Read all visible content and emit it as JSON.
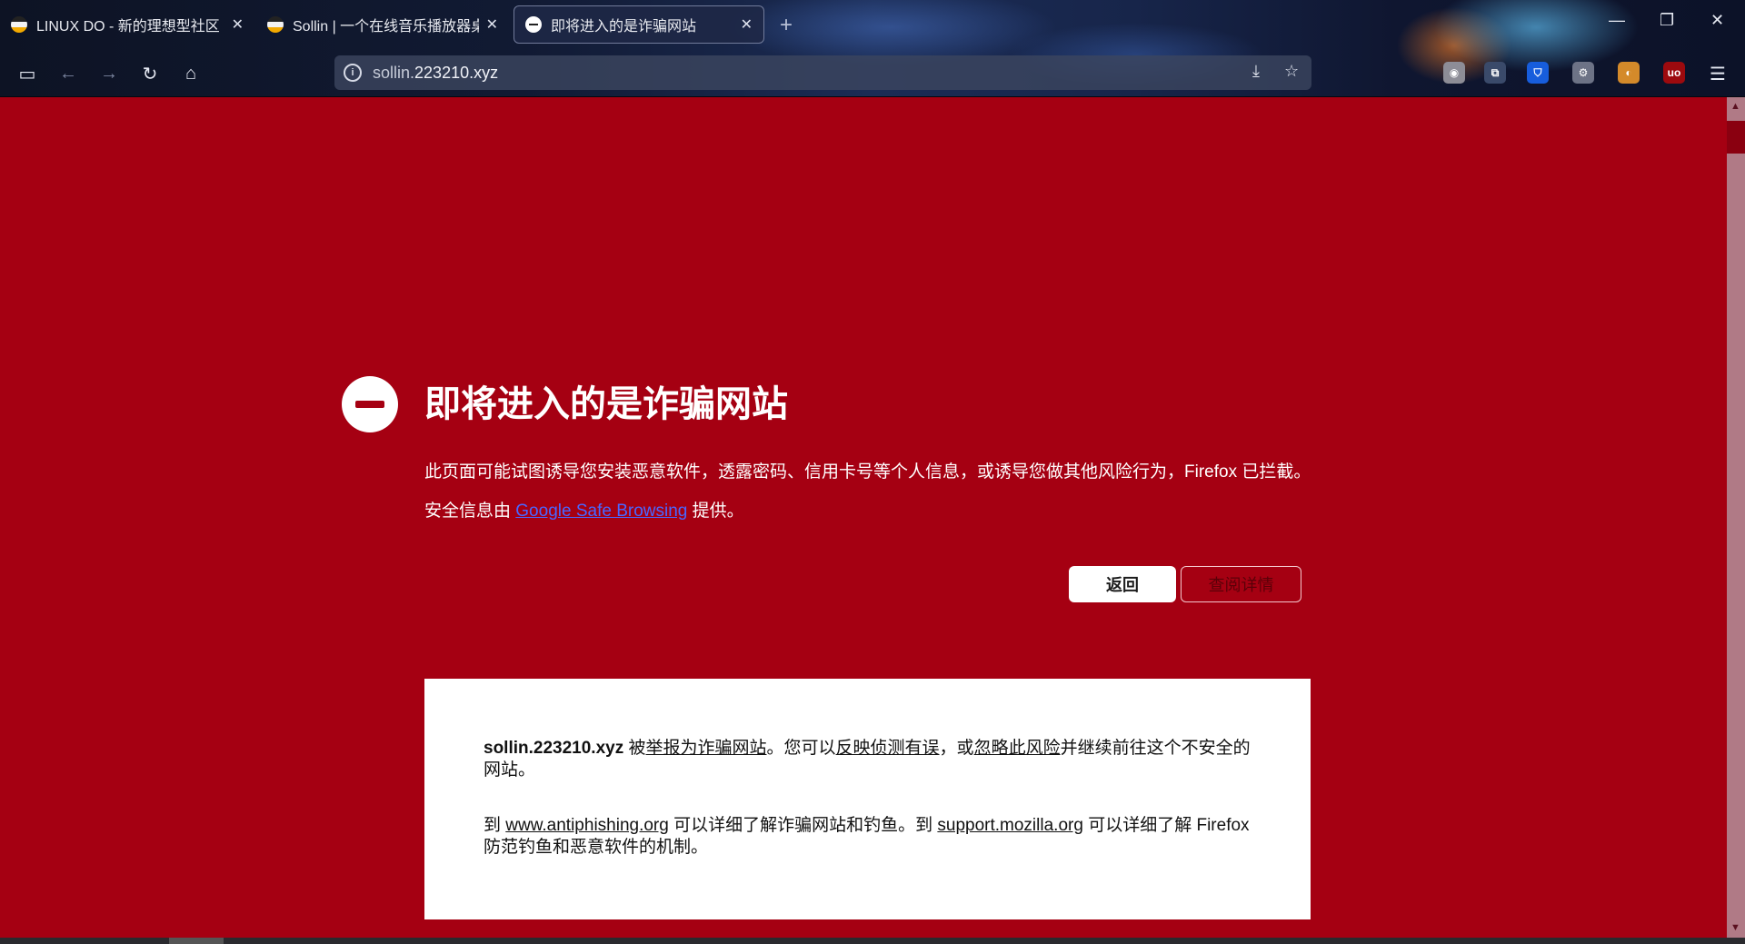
{
  "tabs": [
    {
      "title": "LINUX DO - 新的理想型社区",
      "close": "✕"
    },
    {
      "title": "Sollin | 一个在线音乐播放器桌面",
      "close": "✕"
    },
    {
      "title": "即将进入的是诈骗网站",
      "close": "✕"
    }
  ],
  "newtab": "+",
  "window": {
    "minimize": "—",
    "restore": "❐",
    "close": "✕"
  },
  "nav": {
    "sidebar": "▭",
    "back": "←",
    "forward": "→",
    "reload": "↻",
    "home": "⌂"
  },
  "urlbar": {
    "prefix": "sollin.",
    "domain": "223210.xyz",
    "save_icon": "⤓",
    "star_icon": "☆"
  },
  "extensions": [
    {
      "name": "avatar-ext-icon",
      "label": "◉",
      "color": "#8d8d96"
    },
    {
      "name": "puzzle-ext-icon",
      "label": "⧉",
      "color": "#3a4a6a"
    },
    {
      "name": "bitwarden-ext-icon",
      "label": "⛉",
      "color": "#175ddc"
    },
    {
      "name": "gear-ext-icon",
      "label": "⚙",
      "color": "#6d7386"
    },
    {
      "name": "color-ext-icon",
      "label": "◐",
      "color": "#d48a2a"
    },
    {
      "name": "ublock-ext-icon",
      "label": "uo",
      "color": "#9d0a0e"
    }
  ],
  "menu_icon": "☰",
  "warning": {
    "title": "即将进入的是诈骗网站",
    "description": "此页面可能试图诱导您安装恶意软件，透露密码、信用卡号等个人信息，或诱导您做其他风险行为，Firefox 已拦截。",
    "source_prefix": "安全信息由 ",
    "source_link": "Google Safe Browsing",
    "source_suffix": " 提供。",
    "back_button": "返回",
    "details_button": "查阅详情"
  },
  "details": {
    "site": "sollin.223210.xyz",
    "p1_a": " 被",
    "p1_link1": "举报为诈骗网站",
    "p1_b": "。您可以",
    "p1_link2": "反映侦测有误",
    "p1_c": "，或",
    "p1_link3": "忽略此风险",
    "p1_d": "并继续前往这个不安全的网站。",
    "p2_a": "到 ",
    "p2_link1": "www.antiphishing.org",
    "p2_b": " 可以详细了解诈骗网站和钓鱼。到 ",
    "p2_link2": "support.mozilla.org",
    "p2_c": " 可以详细了解 Firefox 防范钓鱼和恶意软件的机制。"
  },
  "colors": {
    "page_bg": "#a50012",
    "link": "#4a66ff"
  }
}
